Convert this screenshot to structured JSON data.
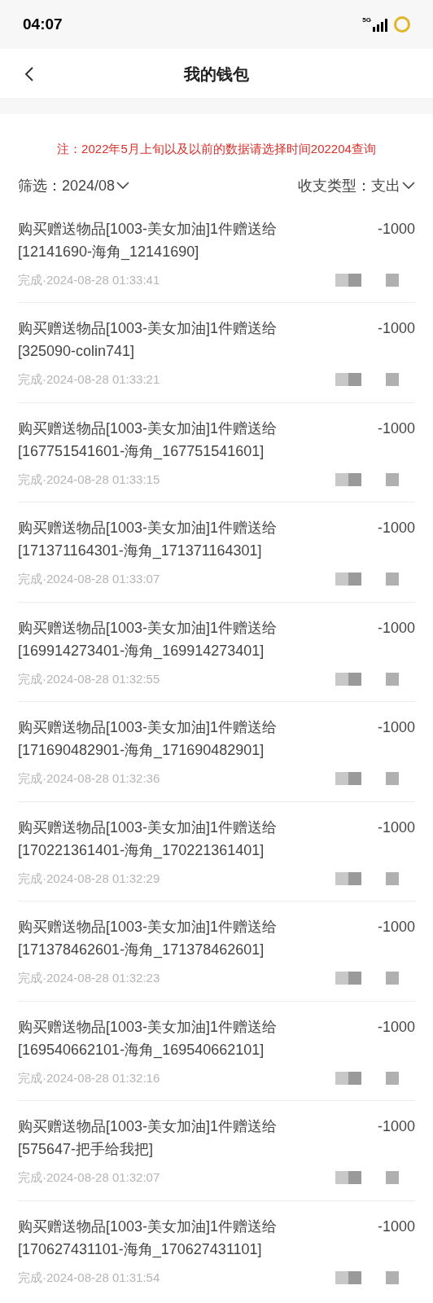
{
  "status_bar": {
    "time": "04:07",
    "network": "5G"
  },
  "header": {
    "title": "我的钱包"
  },
  "notice": "注：2022年5月上旬以及以前的数据请选择时间202204查询",
  "filters": [
    {
      "label": "筛选：",
      "value": "2024/08"
    },
    {
      "label": "收支类型：",
      "value": "支出"
    }
  ],
  "transactions": [
    {
      "description": "购买赠送物品[1003-美女加油]1件赠送给[12141690-海角_12141690]",
      "amount": "-1000",
      "status": "完成·2024-08-28 01:33:41"
    },
    {
      "description": "购买赠送物品[1003-美女加油]1件赠送给[325090-colin741]",
      "amount": "-1000",
      "status": "完成·2024-08-28 01:33:21"
    },
    {
      "description": "购买赠送物品[1003-美女加油]1件赠送给[167751541601-海角_167751541601]",
      "amount": "-1000",
      "status": "完成·2024-08-28 01:33:15"
    },
    {
      "description": "购买赠送物品[1003-美女加油]1件赠送给[171371164301-海角_171371164301]",
      "amount": "-1000",
      "status": "完成·2024-08-28 01:33:07"
    },
    {
      "description": "购买赠送物品[1003-美女加油]1件赠送给[169914273401-海角_169914273401]",
      "amount": "-1000",
      "status": "完成·2024-08-28 01:32:55"
    },
    {
      "description": "购买赠送物品[1003-美女加油]1件赠送给[171690482901-海角_171690482901]",
      "amount": "-1000",
      "status": "完成·2024-08-28 01:32:36"
    },
    {
      "description": "购买赠送物品[1003-美女加油]1件赠送给[170221361401-海角_170221361401]",
      "amount": "-1000",
      "status": "完成·2024-08-28 01:32:29"
    },
    {
      "description": "购买赠送物品[1003-美女加油]1件赠送给[171378462601-海角_171378462601]",
      "amount": "-1000",
      "status": "完成·2024-08-28 01:32:23"
    },
    {
      "description": "购买赠送物品[1003-美女加油]1件赠送给[169540662101-海角_169540662101]",
      "amount": "-1000",
      "status": "完成·2024-08-28 01:32:16"
    },
    {
      "description": "购买赠送物品[1003-美女加油]1件赠送给[575647-把手给我把]",
      "amount": "-1000",
      "status": "完成·2024-08-28 01:32:07"
    },
    {
      "description": "购买赠送物品[1003-美女加油]1件赠送给[170627431101-海角_170627431101]",
      "amount": "-1000",
      "status": "完成·2024-08-28 01:31:54"
    }
  ]
}
